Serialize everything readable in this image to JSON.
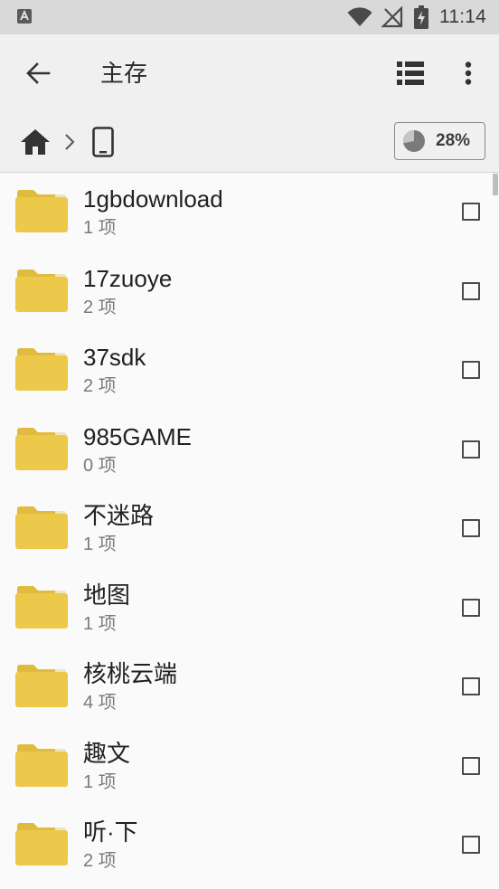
{
  "status_bar": {
    "time": "11:14",
    "notification_icon": "app-notification-icon",
    "icons": [
      "wifi-icon",
      "no-signal-icon",
      "battery-charging-icon"
    ]
  },
  "toolbar": {
    "title": "主存",
    "back_icon": "arrow-left-icon",
    "view_icon": "list-view-icon",
    "more_icon": "more-vert-icon"
  },
  "breadcrumb": {
    "home_icon": "home-icon",
    "separator_icon": "chevron-right-icon",
    "device_icon": "phone-icon"
  },
  "storage": {
    "used_percent_label": "28%",
    "used_fraction": 0.28
  },
  "files": [
    {
      "name": "1gbdownload",
      "meta": "1 项"
    },
    {
      "name": "17zuoye",
      "meta": "2 项"
    },
    {
      "name": "37sdk",
      "meta": "2 项"
    },
    {
      "name": "985GAME",
      "meta": "0 项"
    },
    {
      "name": "不迷路",
      "meta": "1 项"
    },
    {
      "name": "地图",
      "meta": "1 项"
    },
    {
      "name": "核桃云端",
      "meta": "4 项"
    },
    {
      "name": "趣文",
      "meta": "1 项"
    },
    {
      "name": "听·下",
      "meta": "2 项"
    }
  ],
  "colors": {
    "folder": "#ecc94b",
    "folder_tab": "#e1bb3e",
    "toolbar_bg": "#f0f0f0",
    "statusbar_bg": "#d9d9d9"
  }
}
